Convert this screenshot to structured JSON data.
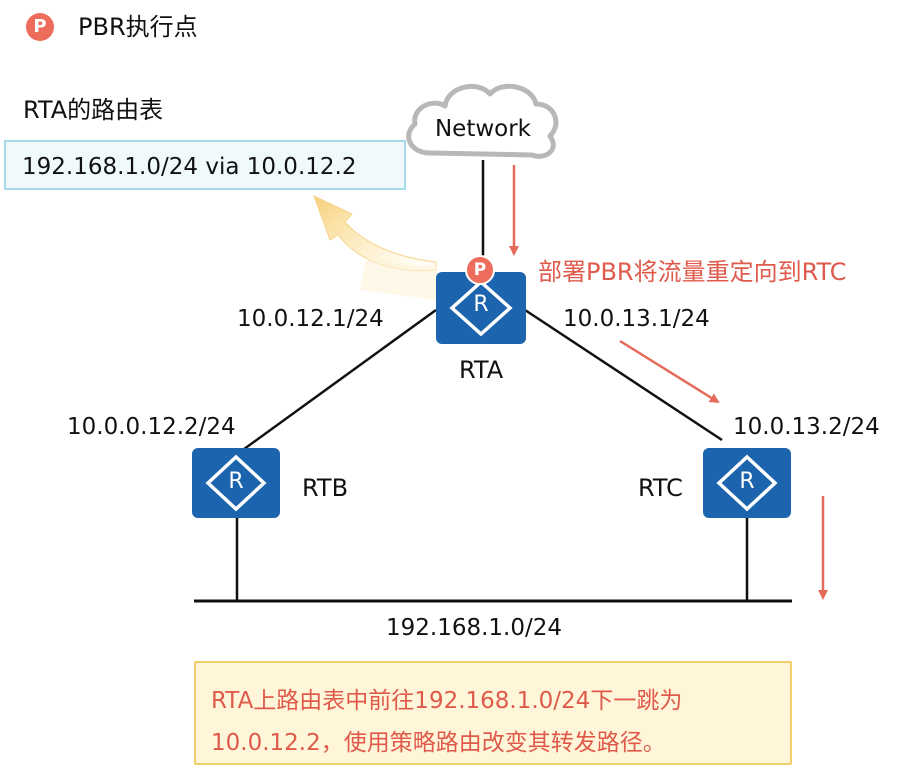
{
  "legend": {
    "badge": "P",
    "label": "PBR执行点"
  },
  "routing_table": {
    "title": "RTA的路由表",
    "entry": "192.168.1.0/24 via 10.0.12.2"
  },
  "cloud_label": "Network",
  "routers": {
    "rta": {
      "name": "RTA",
      "icon": "R",
      "badge": "P"
    },
    "rtb": {
      "name": "RTB",
      "icon": "R"
    },
    "rtc": {
      "name": "RTC",
      "icon": "R"
    }
  },
  "interfaces": {
    "rta_to_rtb": "10.0.12.1/24",
    "rta_to_rtc": "10.0.13.1/24",
    "rtb_to_rta": "10.0.0.12.2/24",
    "rtc_to_rta": "10.0.13.2/24"
  },
  "lan_label": "192.168.1.0/24",
  "pbr_annotation": "部署PBR将流量重定向到RTC",
  "note": {
    "line1": "RTA上路由表中前往192.168.1.0/24下一跳为",
    "line2": "10.0.12.2，使用策略路由改变其转发路径。"
  },
  "colors": {
    "router_fill": "#1c64ad",
    "badge_red": "#ee6c5b",
    "annotation_red": "#e05a4b",
    "arrow_red": "#e46a5a",
    "table_border": "#a6d9ea",
    "note_border": "#f3cf6a",
    "note_fill": "#fff6d9"
  }
}
